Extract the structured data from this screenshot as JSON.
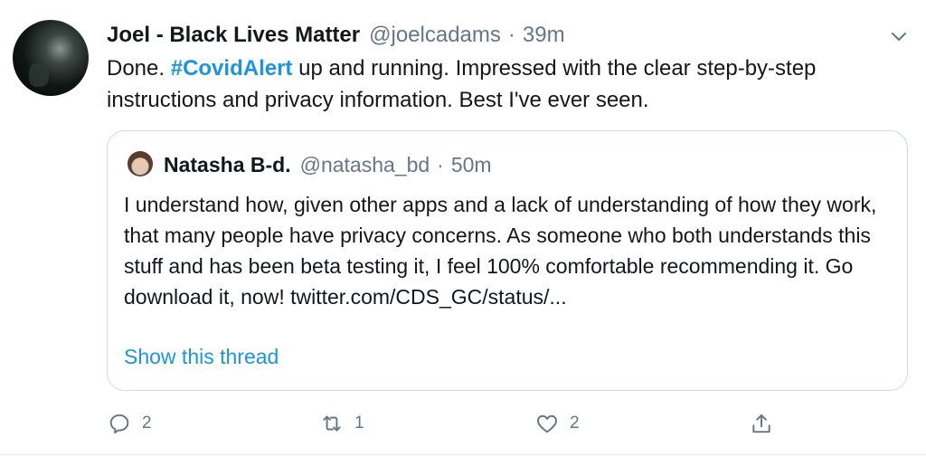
{
  "tweet": {
    "author_name": "Joel - Black Lives Matter",
    "handle": "@joelcadams",
    "separator": "·",
    "time": "39m",
    "text_before": "Done. ",
    "hashtag": "#CovidAlert",
    "text_after": " up and running. Impressed with the clear step-by-step instructions and privacy information. Best I've ever seen."
  },
  "quote": {
    "author_name": "Natasha B-d.",
    "handle": "@natasha_bd",
    "separator": "·",
    "time": "50m",
    "text": "I understand how, given other apps and a lack of understanding of how they work, that many people have privacy concerns. As someone who both understands this stuff and has been beta testing it, I feel 100% comfortable recommending it. Go download it, now! twitter.com/CDS_GC/status/...",
    "show_thread": "Show this thread"
  },
  "actions": {
    "reply_count": "2",
    "retweet_count": "1",
    "like_count": "2"
  },
  "icons": {
    "caret": "chevron-down-icon",
    "reply": "reply-icon",
    "retweet": "retweet-icon",
    "like": "heart-icon",
    "share": "share-icon"
  },
  "colors": {
    "link": "#1b95e0",
    "secondary_text": "#657786",
    "border": "#cfd9de"
  }
}
